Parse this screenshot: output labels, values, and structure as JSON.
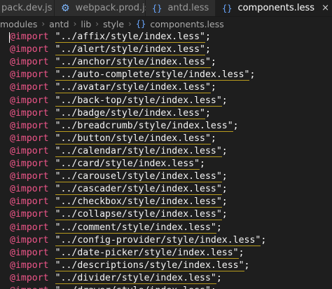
{
  "tabs": [
    {
      "label": "pack.dev.js",
      "icon": "none",
      "active": false
    },
    {
      "label": "webpack.prod.js",
      "icon": "gear-icon",
      "active": false
    },
    {
      "label": "antd.less",
      "icon": "braces-icon",
      "active": false
    },
    {
      "label": "components.less",
      "icon": "braces-icon",
      "active": true,
      "close": "×"
    }
  ],
  "breadcrumb": {
    "items": [
      "modules",
      "antd",
      "lib",
      "style"
    ],
    "file": "components.less",
    "separator": "›"
  },
  "code": {
    "keyword": "@import",
    "terminator": ";",
    "lines": [
      "\"../affix/style/index.less\"",
      "\"../alert/style/index.less\"",
      "\"../anchor/style/index.less\"",
      "\"../auto-complete/style/index.less\"",
      "\"../avatar/style/index.less\"",
      "\"../back-top/style/index.less\"",
      "\"../badge/style/index.less\"",
      "\"../breadcrumb/style/index.less\"",
      "\"../button/style/index.less\"",
      "\"../calendar/style/index.less\"",
      "\"../card/style/index.less\"",
      "\"../carousel/style/index.less\"",
      "\"../cascader/style/index.less\"",
      "\"../checkbox/style/index.less\"",
      "\"../collapse/style/index.less\"",
      "\"../comment/style/index.less\"",
      "\"../config-provider/style/index.less\"",
      "\"../date-picker/style/index.less\"",
      "\"../descriptions/style/index.less\"",
      "\"../divider/style/index.less\"",
      "\"../drawer/style/index.less\""
    ]
  },
  "colors": {
    "background": "#1e1e1e",
    "keyword": "#f0568a",
    "string": "#f4f4f4",
    "underline": "#b89b1e"
  }
}
